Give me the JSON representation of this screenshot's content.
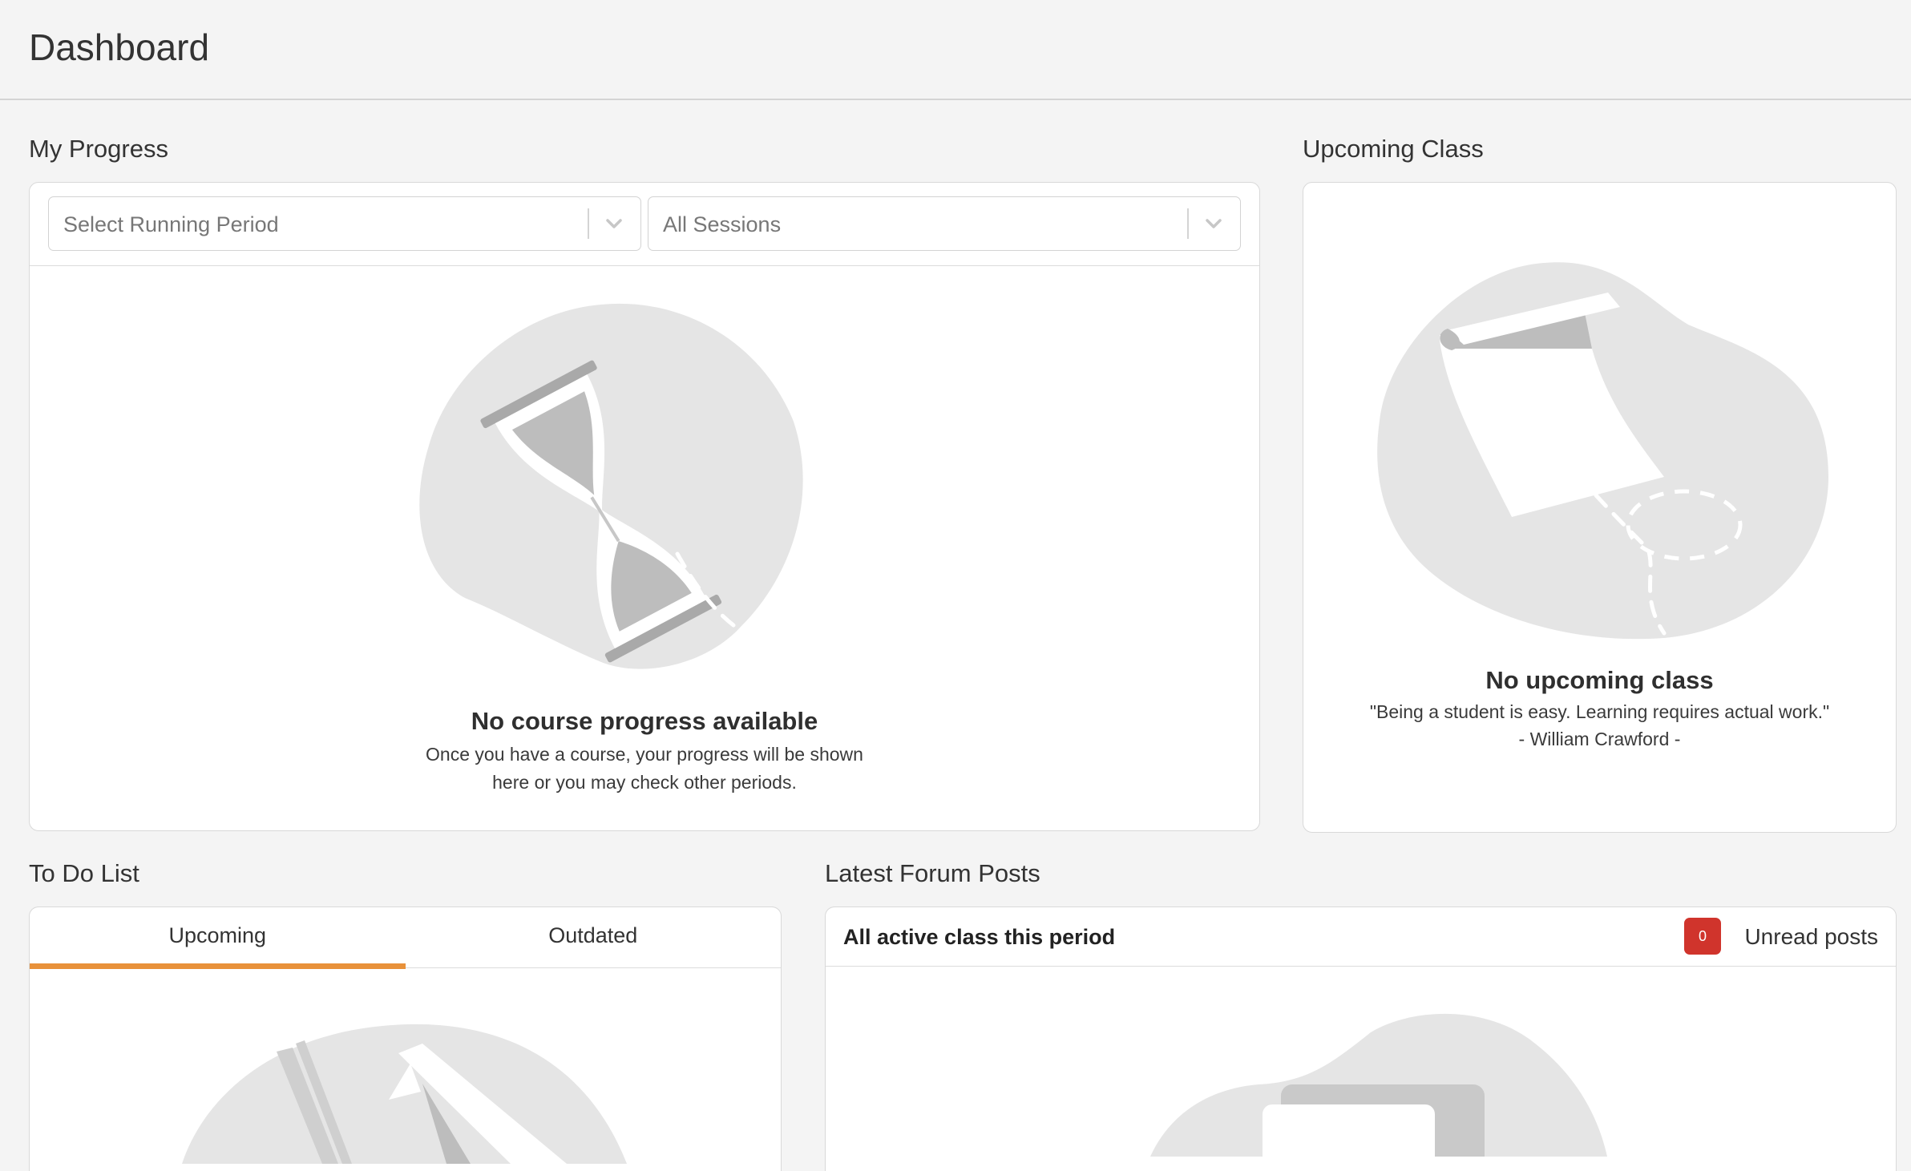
{
  "page": {
    "title": "Dashboard"
  },
  "progress": {
    "section_title": "My Progress",
    "period_select": {
      "placeholder": "Select Running Period"
    },
    "session_select": {
      "value": "All Sessions"
    },
    "empty_title": "No course progress available",
    "empty_text_line1": "Once you have a course, your progress will be shown",
    "empty_text_line2": "here or you may check other periods.",
    "illustration_icon": "hourglass-icon"
  },
  "upcoming_class": {
    "section_title": "Upcoming Class",
    "empty_title": "No upcoming class",
    "quote": "\"Being a student is easy. Learning requires actual work.\"",
    "author": "- William Crawford -",
    "illustration_icon": "map-scroll-icon"
  },
  "todo": {
    "section_title": "To Do List",
    "tabs": [
      {
        "label": "Upcoming",
        "active": true
      },
      {
        "label": "Outdated",
        "active": false
      }
    ],
    "illustration_icon": "pencil-icon"
  },
  "forum": {
    "section_title": "Latest Forum Posts",
    "header_title": "All active class this period",
    "unread_count": "0",
    "unread_label": "Unread posts",
    "illustration_icon": "chat-icon"
  },
  "colors": {
    "accent": "#e8913a",
    "badge": "#d0342c",
    "blob": "#e5e5e5",
    "background": "#f4f4f4"
  }
}
